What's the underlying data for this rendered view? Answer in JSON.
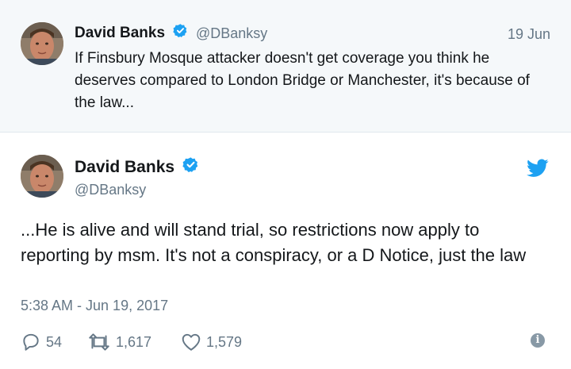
{
  "parent_tweet": {
    "author_name": "David Banks",
    "handle": "@DBanksy",
    "date": "19 Jun",
    "text": "If Finsbury Mosque attacker doesn't get coverage you think he deserves compared to London Bridge or Manchester, it's because of the law..."
  },
  "main_tweet": {
    "author_name": "David Banks",
    "handle": "@DBanksy",
    "text": "...He is alive and will stand trial, so restrictions now apply to reporting by msm. It's not a conspiracy, or a D Notice, just the law",
    "timestamp": "5:38 AM - Jun 19, 2017",
    "reply_count": "54",
    "retweet_count": "1,617",
    "like_count": "1,579"
  },
  "icons": {
    "verified": "verified-badge-icon",
    "brand": "twitter-bird-icon",
    "reply": "reply-bubble-icon",
    "retweet": "retweet-icon",
    "like": "heart-icon",
    "info": "info-icon"
  },
  "colors": {
    "brand_blue": "#1da1f2",
    "muted_text": "#657786",
    "parent_background": "#f5f8fa"
  }
}
